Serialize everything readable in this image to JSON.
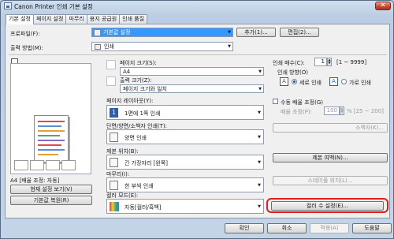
{
  "window": {
    "title": "Canon Printer 인쇄 기본 설정",
    "close": "✕"
  },
  "tabs": [
    "기본 설정",
    "페이지 설정",
    "마무리",
    "용지 공급원",
    "인쇄 품질"
  ],
  "profile": {
    "label": "프로파일(F):",
    "value": "기본값 설정",
    "add": "추가(1)...",
    "edit": "편집(2)..."
  },
  "output_method": {
    "label": "출력 방법(M):",
    "value": "인쇄"
  },
  "preview": {
    "caption": "A4 [배율 조정: 자동]",
    "view_settings": "현재 설정 보기(V)",
    "restore": "기본값 복원(R)"
  },
  "page_size": {
    "label": "페이지 크기(S):",
    "value": "A4"
  },
  "output_size": {
    "label": "출력 크기(Z):",
    "value": "페이지 크기와 일치"
  },
  "layout": {
    "label": "페이지 레이아웃(Y):",
    "value": "1면에 1쪽 인쇄"
  },
  "duplex": {
    "label": "단면/양면/소책자 인쇄(T):",
    "value": "양면 인쇄",
    "booklet": "소책자(K)..."
  },
  "binding": {
    "label": "제본 위치(B):",
    "value": "긴 가장자리 [왼쪽]",
    "margin": "제본 여백(N)..."
  },
  "finishing": {
    "label": "마무리(I):",
    "value": "한 부씩 인쇄",
    "staple": "스테이플 위치(L)..."
  },
  "color": {
    "label": "컬러 모드(E):",
    "value": "자동[컬러/흑백]",
    "settings": "컬러 수 설정(E)..."
  },
  "copies": {
    "label": "인쇄 매수(C):",
    "value": "1",
    "range": "[1 ~ 9999]"
  },
  "orientation": {
    "label": "인쇄 방향(O)",
    "portrait": "세로 인쇄",
    "landscape": "가로 인쇄"
  },
  "manual_scaling": {
    "label": "수동 배율 조정(G)",
    "field_label": "배율 조정(P):",
    "value": "100",
    "range": "% [25 ~ 200]"
  },
  "footer": {
    "ok": "확인",
    "cancel": "취소",
    "apply": "적용(A)",
    "help": "도움말"
  },
  "colors": {
    "accent": "#3399ff",
    "highlight": "#e01e1e"
  }
}
